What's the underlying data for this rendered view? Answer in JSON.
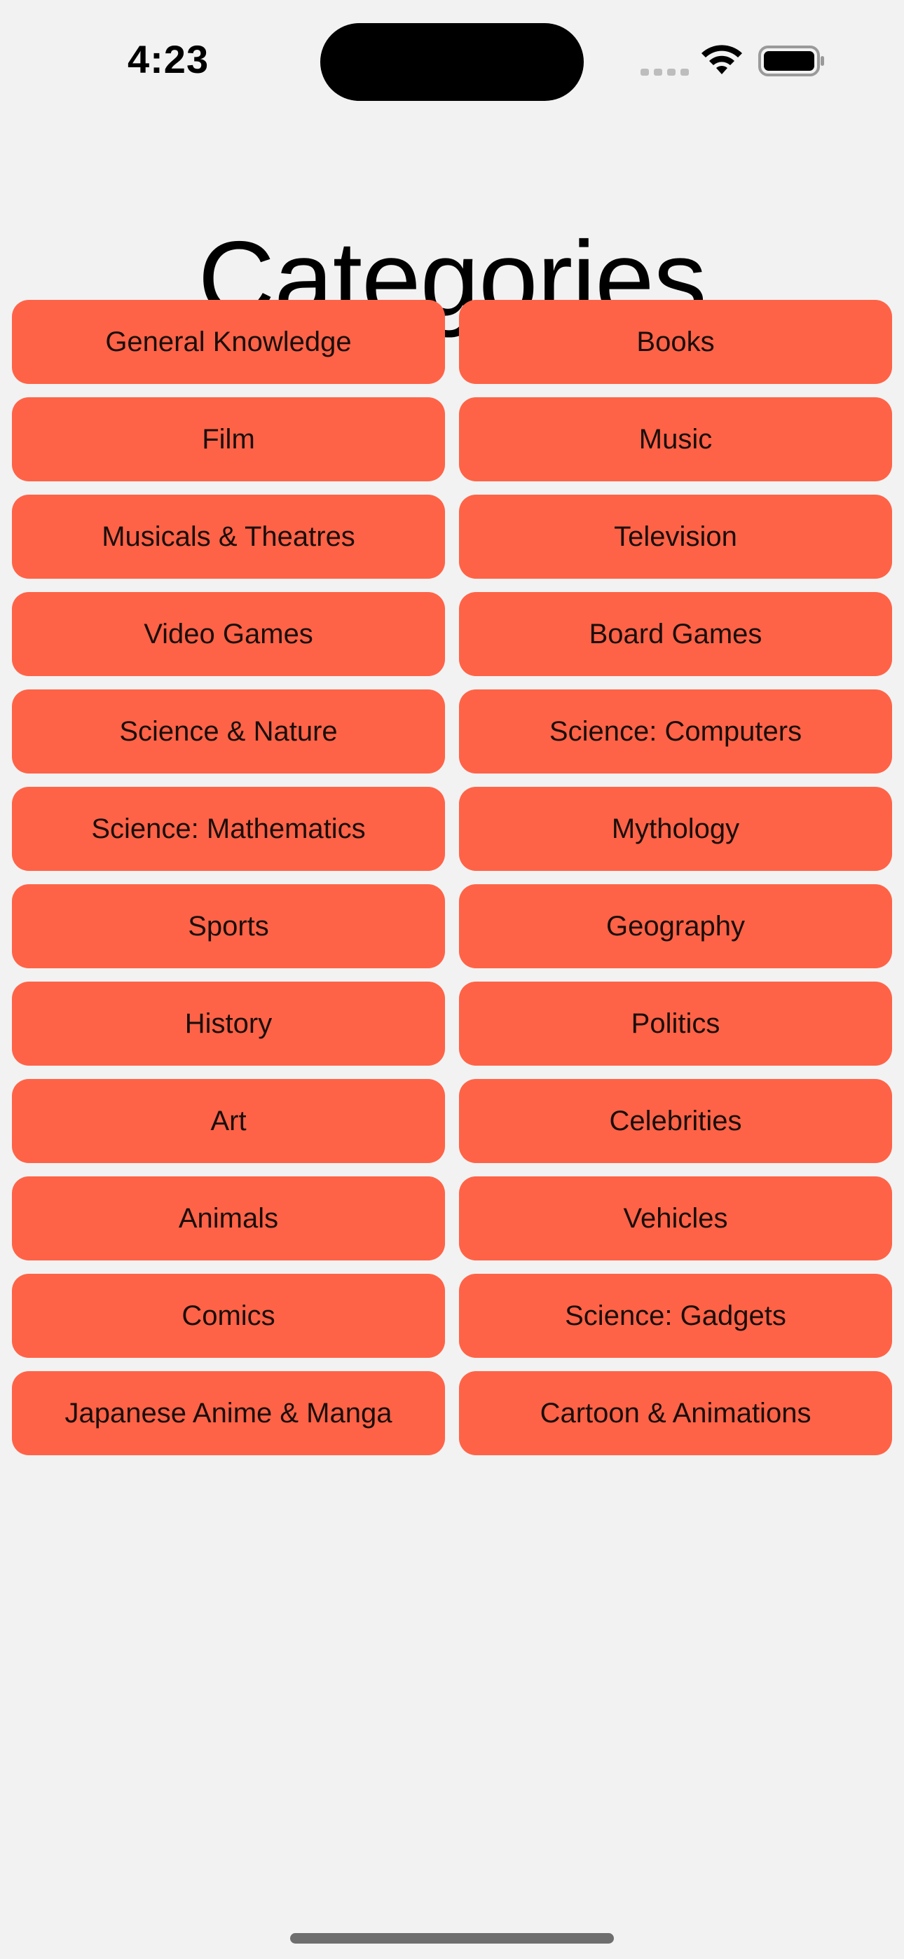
{
  "status_bar": {
    "time": "4:23",
    "icons": [
      "cellular-signal-icon",
      "wifi-icon",
      "battery-icon"
    ]
  },
  "page": {
    "title": "Categories"
  },
  "theme": {
    "button_color": "#ff6347",
    "background": "#f2f2f2"
  },
  "categories": [
    "General Knowledge",
    "Books",
    "Film",
    "Music",
    "Musicals & Theatres",
    "Television",
    "Video Games",
    "Board Games",
    "Science & Nature",
    "Science: Computers",
    "Science: Mathematics",
    "Mythology",
    "Sports",
    "Geography",
    "History",
    "Politics",
    "Art",
    "Celebrities",
    "Animals",
    "Vehicles",
    "Comics",
    "Science: Gadgets",
    "Japanese Anime & Manga",
    "Cartoon & Animations"
  ]
}
